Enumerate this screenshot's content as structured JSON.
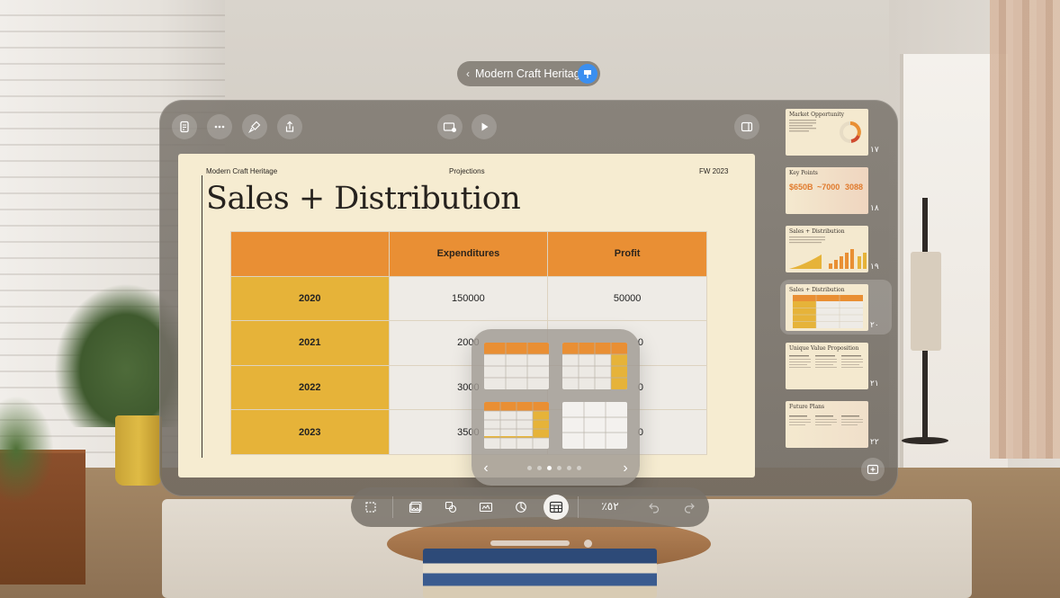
{
  "document": {
    "title": "Modern Craft Heritage"
  },
  "slide": {
    "header_left": "Modern Craft Heritage",
    "header_center": "Projections",
    "header_right": "FW 2023",
    "title": "Sales + Distribution",
    "table": {
      "columns": [
        "",
        "Expenditures",
        "Profit"
      ],
      "rows": [
        {
          "year": "2020",
          "expenditures": "150000",
          "profit": "50000"
        },
        {
          "year": "2021",
          "expenditures": "2000",
          "profit": "0"
        },
        {
          "year": "2022",
          "expenditures": "3000",
          "profit": "0"
        },
        {
          "year": "2023",
          "expenditures": "3500",
          "profit": "0"
        }
      ]
    }
  },
  "bottom_toolbar": {
    "zoom": "٪٥٢"
  },
  "table_styles_popover": {
    "page_count": 6,
    "current_page": 3
  },
  "navigator": {
    "thumbnails": [
      {
        "num": "١٧",
        "title": "Market Opportunity"
      },
      {
        "num": "١٨",
        "title": "Key Points",
        "stats": [
          "$650B",
          "~7000",
          "3088"
        ]
      },
      {
        "num": "١٩",
        "title": "Sales + Distribution"
      },
      {
        "num": "٢٠",
        "title": "Sales + Distribution",
        "selected": true
      },
      {
        "num": "٢١",
        "title": "Unique Value Proposition"
      },
      {
        "num": "٢٢",
        "title": "Future Plans"
      }
    ]
  },
  "colors": {
    "orange_header": "#e98f34",
    "yellow_year": "#e6b339",
    "slide_bg": "#f6ecd1",
    "accent_blue": "#3b8ff0"
  }
}
